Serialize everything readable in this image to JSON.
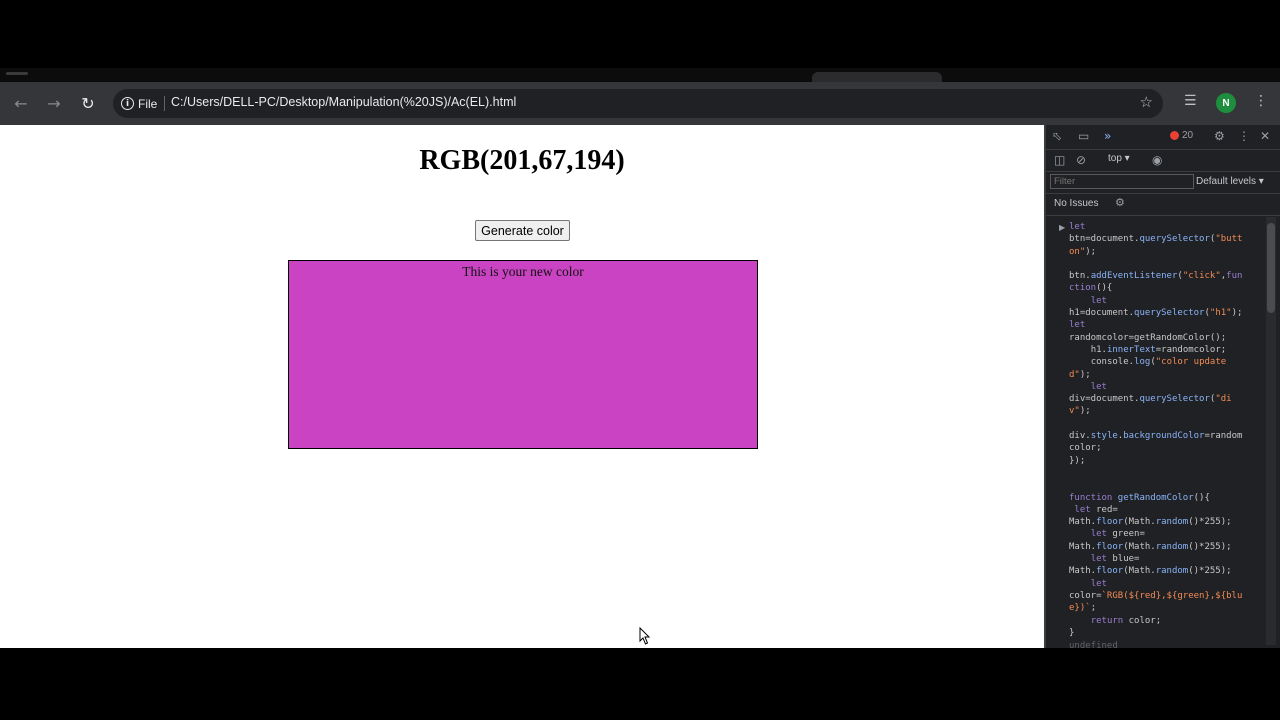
{
  "browser": {
    "address_chip": "File",
    "url": "C:/Users/DELL-PC/Desktop/Manipulation(%20JS)/Ac(EL).html",
    "profile_initial": "N",
    "icons": [
      "back-arrow-icon",
      "forward-arrow-icon",
      "reload-icon",
      "info-icon",
      "star-icon",
      "media-controls-icon",
      "kebab-menu-icon"
    ]
  },
  "page": {
    "heading": "RGB(201,67,194)",
    "button_label": "Generate color",
    "box_text": "This is your new color",
    "box_color": "#c943c2"
  },
  "devtools": {
    "error_count": "20",
    "context": "top ▾",
    "filter_placeholder": "Filter",
    "levels": "Default levels ▾",
    "issues": "No Issues",
    "faded_output": "undefined"
  }
}
